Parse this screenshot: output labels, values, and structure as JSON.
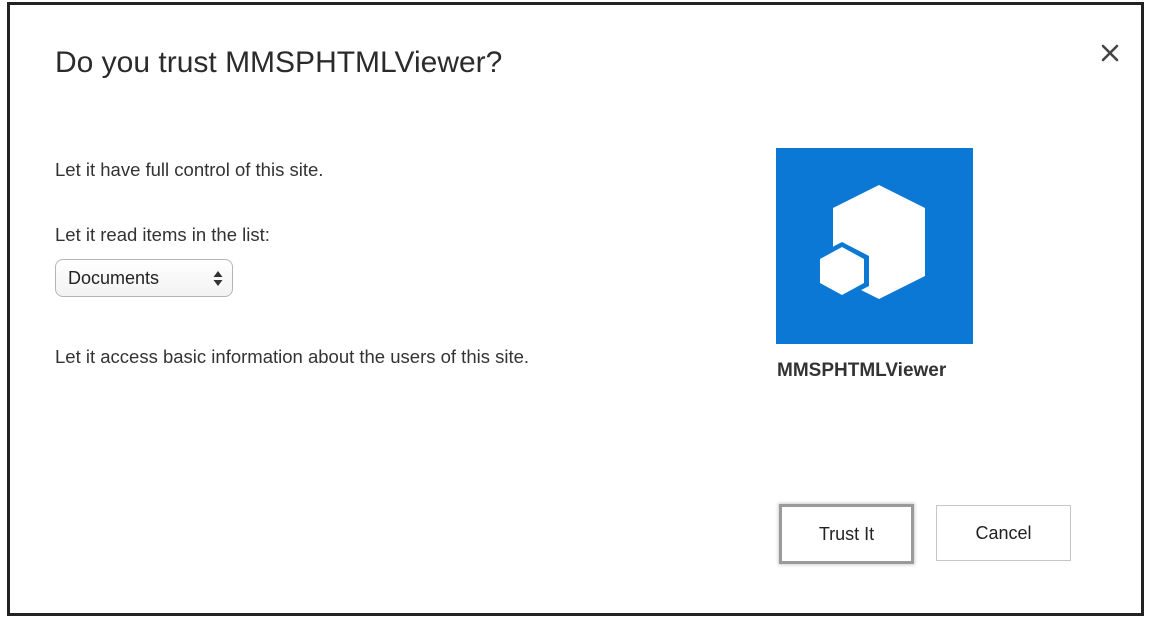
{
  "dialog": {
    "title": "Do you trust MMSPHTMLViewer?",
    "close_icon": "close-icon",
    "permissions": {
      "full_control": "Let it have full control of this site.",
      "read_items": "Let it read items in the list:",
      "user_info": "Let it access basic information about the users of this site."
    },
    "list_select": {
      "selected_value": "Documents",
      "icon": "up-down-arrows-icon"
    },
    "app": {
      "name": "MMSPHTMLViewer",
      "icon": "hexagon-app-icon",
      "icon_color": "#0a78d4"
    },
    "buttons": {
      "trust_label": "Trust It",
      "cancel_label": "Cancel"
    }
  }
}
